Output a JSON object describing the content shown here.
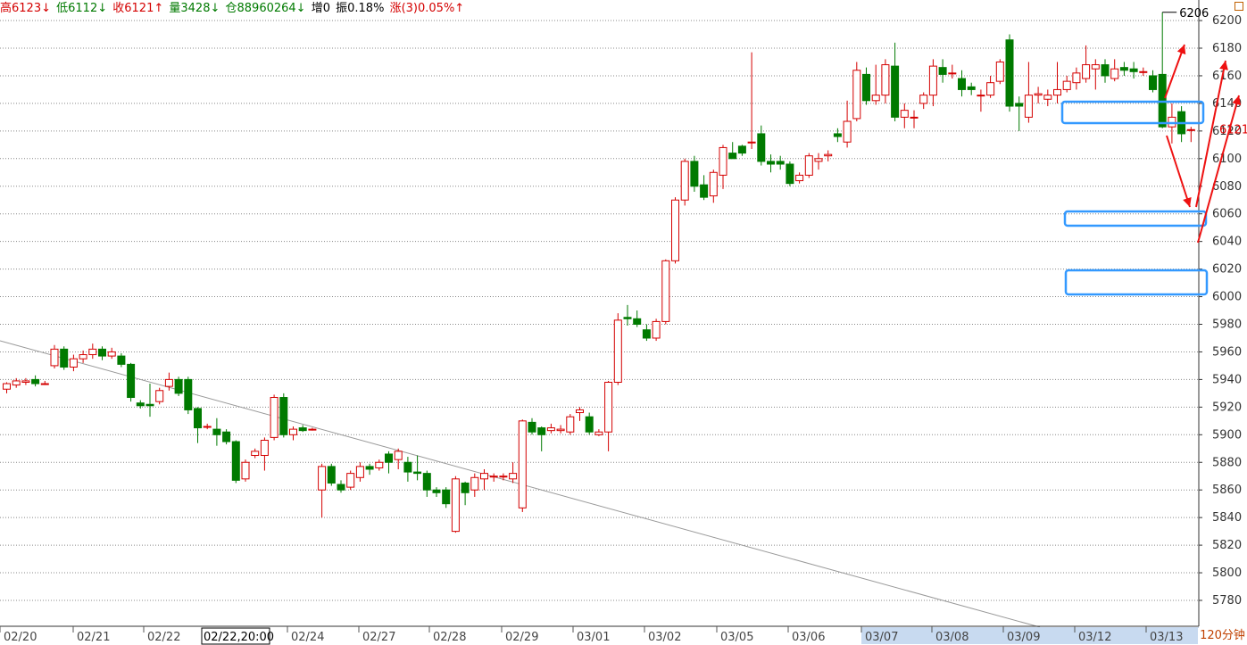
{
  "info": {
    "high_label": "高6123↓",
    "low_label": "低6112↓",
    "close_label": "收6121↑",
    "volume_label": "量3428↓",
    "oi_label": "仓88960264↓",
    "increase_label": "增0",
    "amplitude_label": "振0.18%",
    "change_label": "涨(3)0.05%↑"
  },
  "period_label": "120分钟",
  "colors": {
    "up": "#d40000",
    "down": "#007a00",
    "grid": "#888888",
    "marker": "#3399ff",
    "arrow": "#ee1111"
  },
  "chart_data": {
    "type": "candlestick",
    "ylim": [
      5780,
      6222
    ],
    "yticks": [
      5780,
      5800,
      5820,
      5840,
      5860,
      5880,
      5900,
      5920,
      5940,
      5960,
      5980,
      6000,
      6020,
      6040,
      6060,
      6080,
      6100,
      6120,
      6140,
      6160,
      6180,
      6200
    ],
    "last_price": "6121",
    "high_annotation": "6206",
    "x_labels": [
      "02/20",
      "02/21",
      "02/22",
      "02/22,20:00",
      "02/24",
      "02/27",
      "02/28",
      "02/29",
      "03/01",
      "03/02",
      "03/05",
      "03/06",
      "03/07",
      "03/08",
      "03/09",
      "03/12",
      "03/13"
    ],
    "highlighted_x_labels": [
      "03/07",
      "03/08",
      "03/09",
      "03/12",
      "03/13"
    ],
    "cursor_x_label": "02/22,20:00",
    "candles": [
      [
        5933,
        5937,
        5938,
        5930
      ],
      [
        5936,
        5939,
        5941,
        5934
      ],
      [
        5938,
        5939,
        5941,
        5936
      ],
      [
        5940,
        5937,
        5943,
        5935
      ],
      [
        5937,
        5937,
        5939,
        5936
      ],
      [
        5950,
        5962,
        5965,
        5948
      ],
      [
        5962,
        5949,
        5964,
        5947
      ],
      [
        5949,
        5955,
        5958,
        5946
      ],
      [
        5955,
        5958,
        5961,
        5952
      ],
      [
        5958,
        5962,
        5966,
        5955
      ],
      [
        5962,
        5957,
        5964,
        5954
      ],
      [
        5957,
        5960,
        5963,
        5955
      ],
      [
        5957,
        5951,
        5959,
        5949
      ],
      [
        5951,
        5927,
        5952,
        5924
      ],
      [
        5923,
        5921,
        5925,
        5919
      ],
      [
        5922,
        5921,
        5937,
        5913
      ],
      [
        5924,
        5932,
        5934,
        5922
      ],
      [
        5935,
        5940,
        5945,
        5932
      ],
      [
        5940,
        5930,
        5942,
        5928
      ],
      [
        5940,
        5918,
        5942,
        5915
      ],
      [
        5919,
        5905,
        5920,
        5894
      ],
      [
        5906,
        5906,
        5908,
        5904
      ],
      [
        5904,
        5900,
        5912,
        5892
      ],
      [
        5902,
        5895,
        5904,
        5893
      ],
      [
        5895,
        5867,
        5896,
        5865
      ],
      [
        5868,
        5880,
        5882,
        5866
      ],
      [
        5885,
        5888,
        5890,
        5883
      ],
      [
        5885,
        5896,
        5898,
        5874
      ],
      [
        5898,
        5927,
        5929,
        5896
      ],
      [
        5927,
        5900,
        5930,
        5898
      ],
      [
        5900,
        5904,
        5906,
        5896
      ],
      [
        5905,
        5903,
        5907,
        5902
      ],
      [
        5904,
        5904,
        5905,
        5903
      ],
      [
        5860,
        5877,
        5879,
        5840
      ],
      [
        5877,
        5865,
        5879,
        5863
      ],
      [
        5864,
        5860,
        5867,
        5858
      ],
      [
        5862,
        5872,
        5874,
        5860
      ],
      [
        5869,
        5877,
        5880,
        5866
      ],
      [
        5877,
        5875,
        5879,
        5871
      ],
      [
        5876,
        5880,
        5882,
        5874
      ],
      [
        5886,
        5880,
        5888,
        5872
      ],
      [
        5882,
        5888,
        5890,
        5875
      ],
      [
        5880,
        5873,
        5884,
        5866
      ],
      [
        5873,
        5872,
        5885,
        5867
      ],
      [
        5872,
        5860,
        5874,
        5855
      ],
      [
        5860,
        5858,
        5862,
        5855
      ],
      [
        5860,
        5850,
        5862,
        5847
      ],
      [
        5830,
        5868,
        5870,
        5829
      ],
      [
        5865,
        5858,
        5866,
        5849
      ],
      [
        5860,
        5869,
        5872,
        5855
      ],
      [
        5868,
        5872,
        5875,
        5860
      ],
      [
        5870,
        5870,
        5872,
        5866
      ],
      [
        5870,
        5870,
        5872,
        5867
      ],
      [
        5868,
        5872,
        5880,
        5865
      ],
      [
        5847,
        5910,
        5911,
        5844
      ],
      [
        5909,
        5902,
        5912,
        5900
      ],
      [
        5905,
        5900,
        5906,
        5888
      ],
      [
        5903,
        5905,
        5908,
        5901
      ],
      [
        5903,
        5904,
        5907,
        5901
      ],
      [
        5902,
        5913,
        5915,
        5900
      ],
      [
        5916,
        5918,
        5920,
        5910
      ],
      [
        5913,
        5902,
        5916,
        5900
      ],
      [
        5900,
        5902,
        5904,
        5899
      ],
      [
        5902,
        5938,
        5939,
        5888
      ],
      [
        5938,
        5983,
        5988,
        5936
      ],
      [
        5985,
        5984,
        5994,
        5979
      ],
      [
        5984,
        5980,
        5990,
        5978
      ],
      [
        5976,
        5970,
        5980,
        5968
      ],
      [
        5970,
        5982,
        5984,
        5968
      ],
      [
        5982,
        6026,
        6027,
        5980
      ],
      [
        6026,
        6070,
        6072,
        6024
      ],
      [
        6070,
        6098,
        6100,
        6066
      ],
      [
        6098,
        6080,
        6102,
        6076
      ],
      [
        6081,
        6072,
        6088,
        6070
      ],
      [
        6073,
        6090,
        6092,
        6068
      ],
      [
        6088,
        6108,
        6110,
        6078
      ],
      [
        6104,
        6100,
        6112,
        6100
      ],
      [
        6109,
        6104,
        6110,
        6102
      ],
      [
        6112,
        6112,
        6177,
        6107
      ],
      [
        6118,
        6098,
        6124,
        6095
      ],
      [
        6098,
        6096,
        6103,
        6090
      ],
      [
        6098,
        6096,
        6102,
        6092
      ],
      [
        6096,
        6082,
        6098,
        6080
      ],
      [
        6084,
        6088,
        6090,
        6082
      ],
      [
        6088,
        6102,
        6104,
        6086
      ],
      [
        6098,
        6100,
        6104,
        6092
      ],
      [
        6102,
        6103,
        6106,
        6098
      ],
      [
        6118,
        6116,
        6122,
        6112
      ],
      [
        6112,
        6127,
        6142,
        6108
      ],
      [
        6129,
        6164,
        6170,
        6127
      ],
      [
        6161,
        6142,
        6166,
        6139
      ],
      [
        6142,
        6146,
        6168,
        6139
      ],
      [
        6146,
        6168,
        6172,
        6140
      ],
      [
        6167,
        6130,
        6184,
        6127
      ],
      [
        6130,
        6135,
        6140,
        6122
      ],
      [
        6130,
        6130,
        6135,
        6122
      ],
      [
        6140,
        6146,
        6148,
        6136
      ],
      [
        6146,
        6167,
        6172,
        6138
      ],
      [
        6166,
        6161,
        6172,
        6155
      ],
      [
        6162,
        6162,
        6168,
        6158
      ],
      [
        6158,
        6150,
        6164,
        6145
      ],
      [
        6152,
        6150,
        6155,
        6146
      ],
      [
        6146,
        6146,
        6150,
        6134
      ],
      [
        6146,
        6155,
        6160,
        6144
      ],
      [
        6156,
        6170,
        6172,
        6154
      ],
      [
        6186,
        6138,
        6190,
        6134
      ],
      [
        6140,
        6138,
        6145,
        6120
      ],
      [
        6130,
        6146,
        6170,
        6126
      ],
      [
        6146,
        6147,
        6152,
        6140
      ],
      [
        6143,
        6146,
        6150,
        6138
      ],
      [
        6146,
        6150,
        6170,
        6140
      ],
      [
        6150,
        6156,
        6160,
        6148
      ],
      [
        6155,
        6162,
        6166,
        6150
      ],
      [
        6158,
        6168,
        6182,
        6155
      ],
      [
        6165,
        6168,
        6172,
        6150
      ],
      [
        6168,
        6160,
        6172,
        6155
      ],
      [
        6158,
        6165,
        6172,
        6156
      ],
      [
        6166,
        6164,
        6170,
        6160
      ],
      [
        6165,
        6163,
        6170,
        6158
      ],
      [
        6163,
        6163,
        6166,
        6160
      ],
      [
        6160,
        6150,
        6164,
        6148
      ],
      [
        6161,
        6123,
        6206,
        6122
      ],
      [
        6123,
        6130,
        6140,
        6111
      ],
      [
        6134,
        6118,
        6138,
        6112
      ],
      [
        6121,
        6121,
        6123,
        6112
      ]
    ]
  }
}
